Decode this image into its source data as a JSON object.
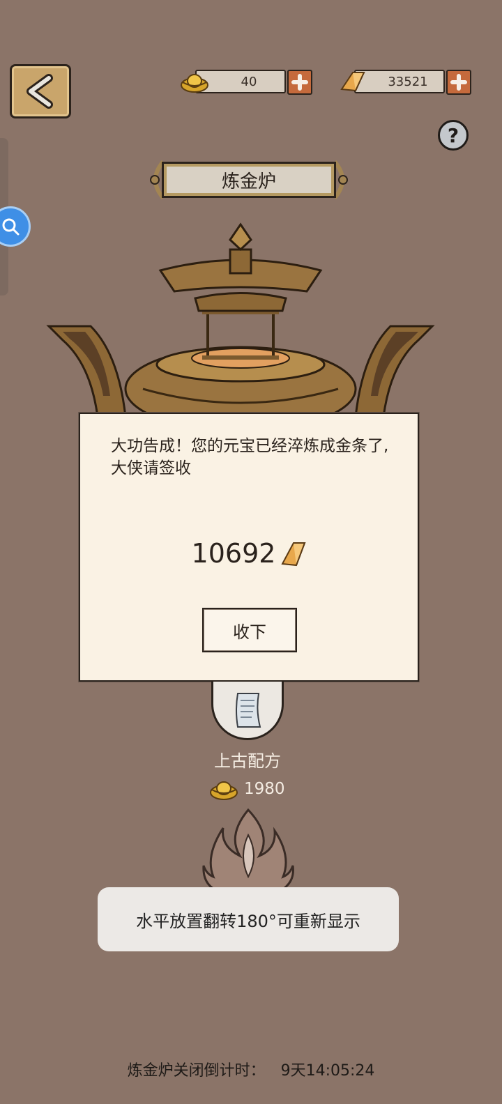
{
  "header": {
    "yuanbao_amount": "40",
    "gold_bar_amount": "33521",
    "help_label": "?"
  },
  "title": "炼金炉",
  "dialog": {
    "message": "大功告成！您的元宝已经淬炼成金条了,大侠请签收",
    "reward_amount": "10692",
    "accept_label": "收下"
  },
  "recipe": {
    "name": "上古配方",
    "cost": "1980"
  },
  "toast": "水平放置翻转180°可重新显示",
  "countdown": {
    "label": "炼金炉关闭倒计时：",
    "time": "9天14:05:24"
  },
  "colors": {
    "background": "#8b7468",
    "dialog_bg": "#faf2e4",
    "accent_plus": "#c56a3c",
    "gold": "#c9a56b"
  }
}
